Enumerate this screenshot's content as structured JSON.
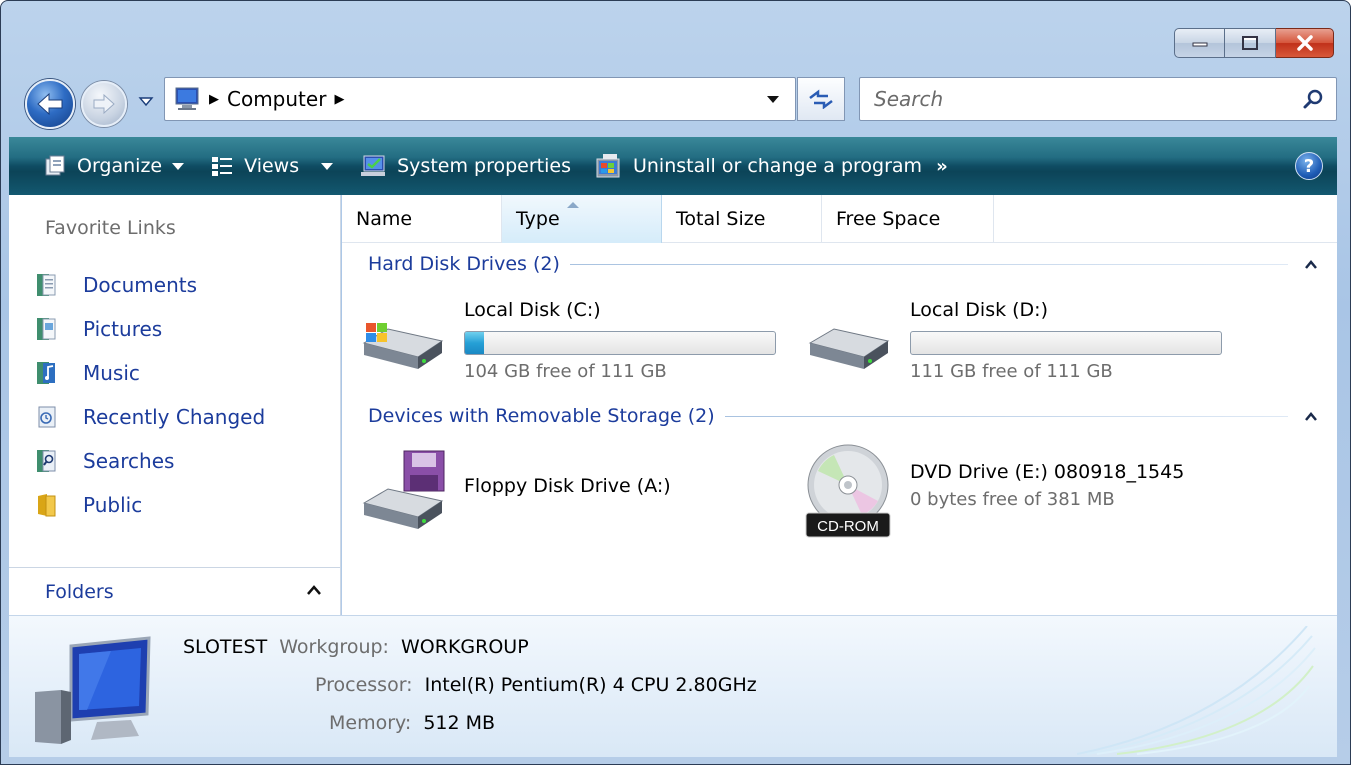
{
  "window": {
    "caption_buttons": [
      "minimize",
      "maximize",
      "close"
    ]
  },
  "navigation": {
    "back_icon": "back-arrow-icon",
    "forward_icon": "forward-arrow-icon",
    "address": {
      "icon": "computer-icon",
      "breadcrumbs": [
        "Computer"
      ]
    },
    "search": {
      "placeholder": "Search"
    }
  },
  "toolbar": {
    "organize": "Organize",
    "views": "Views",
    "system_properties": "System properties",
    "uninstall": "Uninstall or change a program",
    "more": "»",
    "help": "?"
  },
  "nav_pane": {
    "favorite_links_title": "Favorite Links",
    "links": [
      {
        "label": "Documents",
        "icon": "documents-icon"
      },
      {
        "label": "Pictures",
        "icon": "pictures-icon"
      },
      {
        "label": "Music",
        "icon": "music-icon"
      },
      {
        "label": "Recently Changed",
        "icon": "recently-changed-icon"
      },
      {
        "label": "Searches",
        "icon": "searches-icon"
      },
      {
        "label": "Public",
        "icon": "public-folder-icon"
      }
    ],
    "folders_label": "Folders"
  },
  "columns": [
    "Name",
    "Type",
    "Total Size",
    "Free Space"
  ],
  "sorted_column": "Type",
  "groups": {
    "hard_disks": {
      "title": "Hard Disk Drives (2)",
      "drives": [
        {
          "name": "Local Disk (C:)",
          "free_text": "104 GB free of 111 GB",
          "used_fraction": 0.06,
          "icon": "windows-disk-icon"
        },
        {
          "name": "Local Disk (D:)",
          "free_text": "111 GB free of 111 GB",
          "used_fraction": 0.0,
          "icon": "hard-disk-icon"
        }
      ]
    },
    "removable": {
      "title": "Devices with Removable Storage (2)",
      "drives": [
        {
          "name": "Floppy Disk Drive (A:)",
          "free_text": "",
          "icon": "floppy-drive-icon"
        },
        {
          "name": "DVD Drive (E:) 080918_1545",
          "free_text": "0 bytes free of 381 MB",
          "icon": "cd-rom-icon",
          "badge": "CD-ROM"
        }
      ]
    }
  },
  "details": {
    "computer_name": "SLOTEST",
    "workgroup_label": "Workgroup:",
    "workgroup_value": "WORKGROUP",
    "processor_label": "Processor:",
    "processor_value": "Intel(R) Pentium(R) 4 CPU 2.80GHz",
    "memory_label": "Memory:",
    "memory_value": "512 MB"
  },
  "colors": {
    "link_blue": "#1c3c9c",
    "toolbar_teal": "#0f4c63",
    "close_red": "#c0311a",
    "progress_blue": "#26a0d6"
  }
}
